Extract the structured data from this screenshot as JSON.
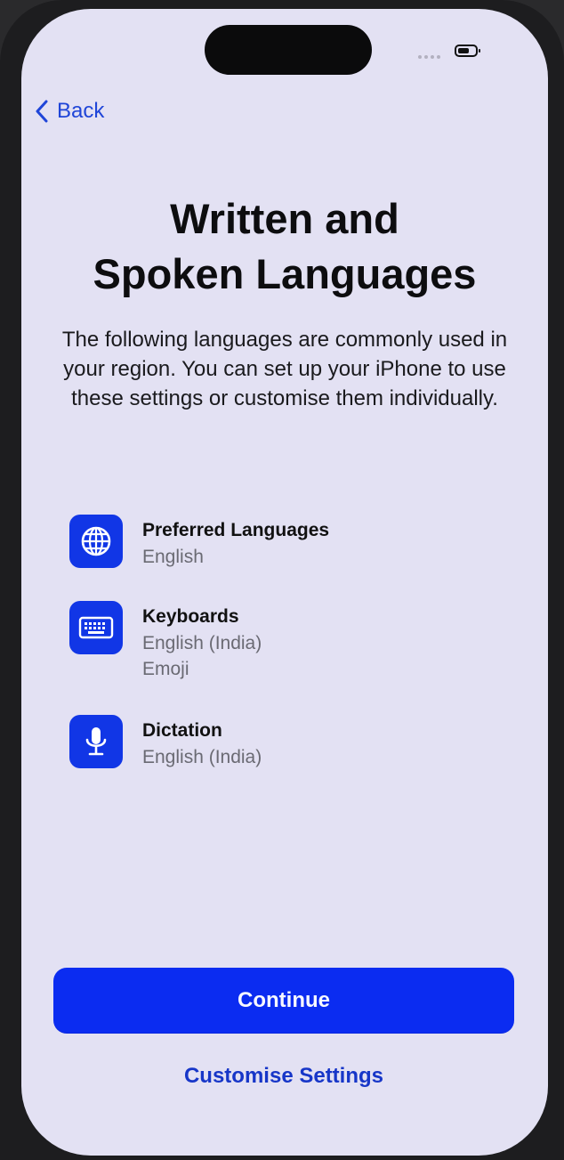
{
  "header": {
    "back_label": "Back"
  },
  "page": {
    "title_line1": "Written and",
    "title_line2": "Spoken Languages",
    "description": "The following languages are commonly used in your region. You can set up your iPhone to use these settings or customise them individually."
  },
  "settings": {
    "preferred_languages": {
      "title": "Preferred Languages",
      "value1": "English",
      "icon": "globe-icon"
    },
    "keyboards": {
      "title": "Keyboards",
      "value1": "English (India)",
      "value2": "Emoji",
      "icon": "keyboard-icon"
    },
    "dictation": {
      "title": "Dictation",
      "value1": "English (India)",
      "icon": "microphone-icon"
    }
  },
  "actions": {
    "continue_label": "Continue",
    "customise_label": "Customise Settings"
  },
  "colors": {
    "accent": "#0b2cf1",
    "background": "#e3e1f3"
  }
}
